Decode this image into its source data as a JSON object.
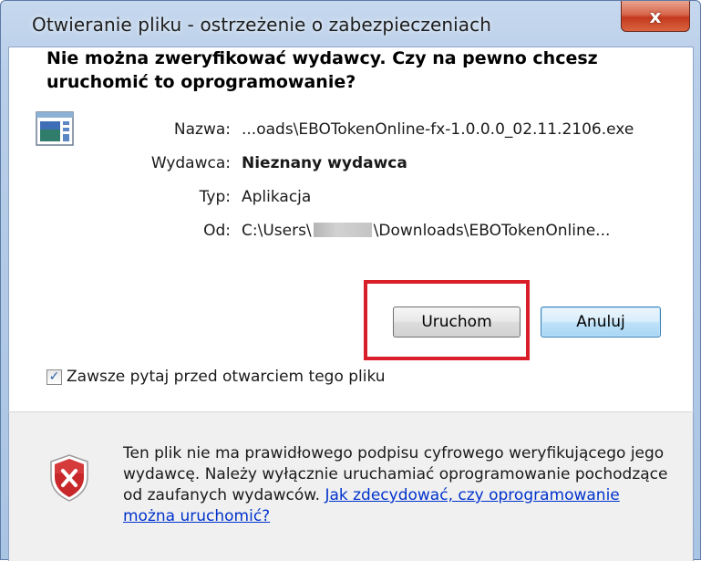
{
  "window": {
    "title": "Otwieranie pliku - ostrzeżenie o zabezpieczeniach",
    "close_label": "x"
  },
  "headline": "Nie można zweryfikować wydawcy. Czy na pewno chcesz uruchomić to oprogramowanie?",
  "fields": {
    "name_label": "Nazwa:",
    "name_value": "...oads\\EBOTokenOnline-fx-1.0.0.0_02.11.2106.exe",
    "publisher_label": "Wydawca:",
    "publisher_value": "Nieznany wydawca",
    "type_label": "Typ:",
    "type_value": "Aplikacja",
    "from_label": "Od:",
    "from_value_prefix": "C:\\Users\\",
    "from_value_suffix": "\\Downloads\\EBOTokenOnline..."
  },
  "buttons": {
    "run_label": "Uruchom",
    "cancel_label": "Anuluj"
  },
  "checkbox": {
    "label": "Zawsze pytaj przed otwarciem tego pliku",
    "checked": true
  },
  "warning": {
    "text": "Ten plik nie ma prawidłowego podpisu cyfrowego weryfikującego jego wydawcę. Należy wyłącznie uruchamiać oprogramowanie pochodzące od zaufanych wydawców. ",
    "link_label": "Jak zdecydować, czy oprogramowanie można uruchomić?"
  },
  "icons": {
    "file": "application-file-icon",
    "shield": "security-shield-error-icon",
    "close": "close-icon",
    "check": "checkmark-icon"
  },
  "colors": {
    "highlight": "#d81e28",
    "link": "#0033cc",
    "close_button": "#c43a1f"
  }
}
